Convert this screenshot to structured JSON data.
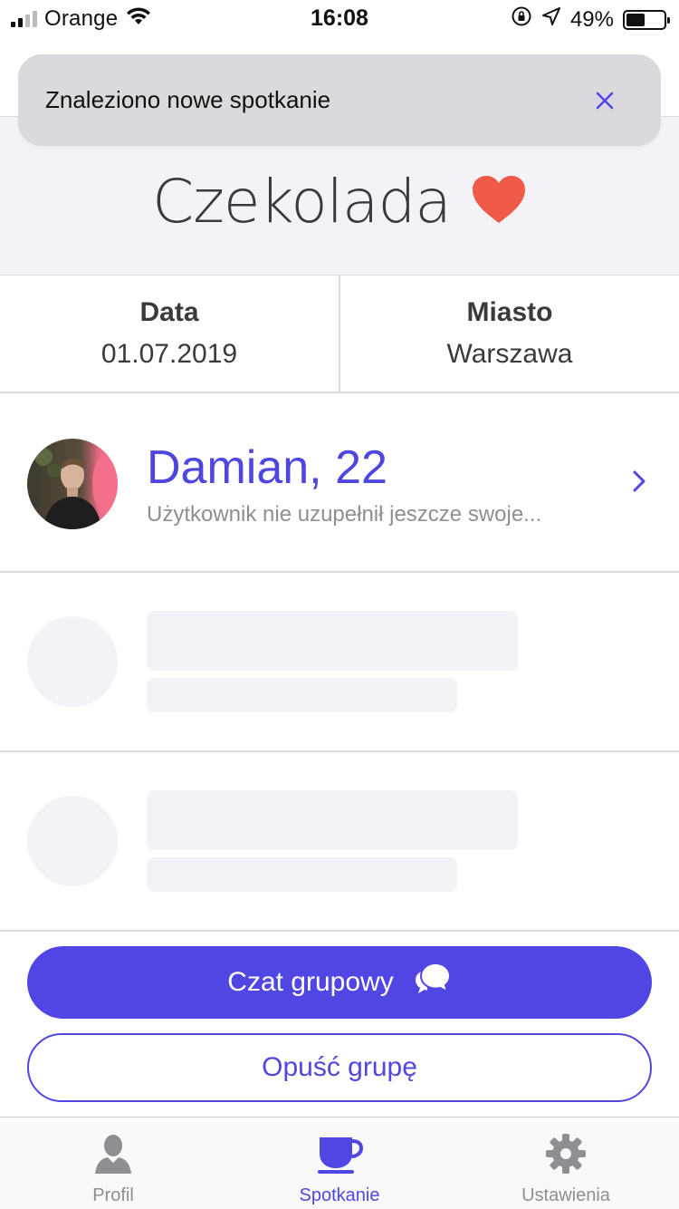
{
  "status_bar": {
    "carrier": "Orange",
    "time": "16:08",
    "battery_percent": "49%",
    "battery_level": 0.49,
    "icons": [
      "signal-icon",
      "wifi-icon",
      "orientation-lock-icon",
      "location-icon",
      "battery-icon"
    ]
  },
  "toast": {
    "message": "Znaleziono nowe spotkanie",
    "close_icon": "close-icon"
  },
  "group": {
    "name": "Czekolada",
    "icon": "heart-icon",
    "heart_color": "#f05a48"
  },
  "info": {
    "date_label": "Data",
    "date_value": "01.07.2019",
    "city_label": "Miasto",
    "city_value": "Warszawa"
  },
  "members": [
    {
      "name": "Damian, 22",
      "description": "Użytkownik nie uzupełnił jeszcze swoje...",
      "avatar": "avatar-photo"
    }
  ],
  "buttons": {
    "group_chat": "Czat grupowy",
    "group_chat_icon": "chat-bubbles-icon",
    "leave_group": "Opuść grupę"
  },
  "tabs": [
    {
      "label": "Profil",
      "icon": "person-icon",
      "active": false
    },
    {
      "label": "Spotkanie",
      "icon": "cup-icon",
      "active": true
    },
    {
      "label": "Ustawienia",
      "icon": "gear-icon",
      "active": false
    }
  ],
  "colors": {
    "accent": "#5146e4",
    "header_bg": "#f2f2f7",
    "toast_bg": "#dadade",
    "muted_text": "#8e8e93"
  }
}
